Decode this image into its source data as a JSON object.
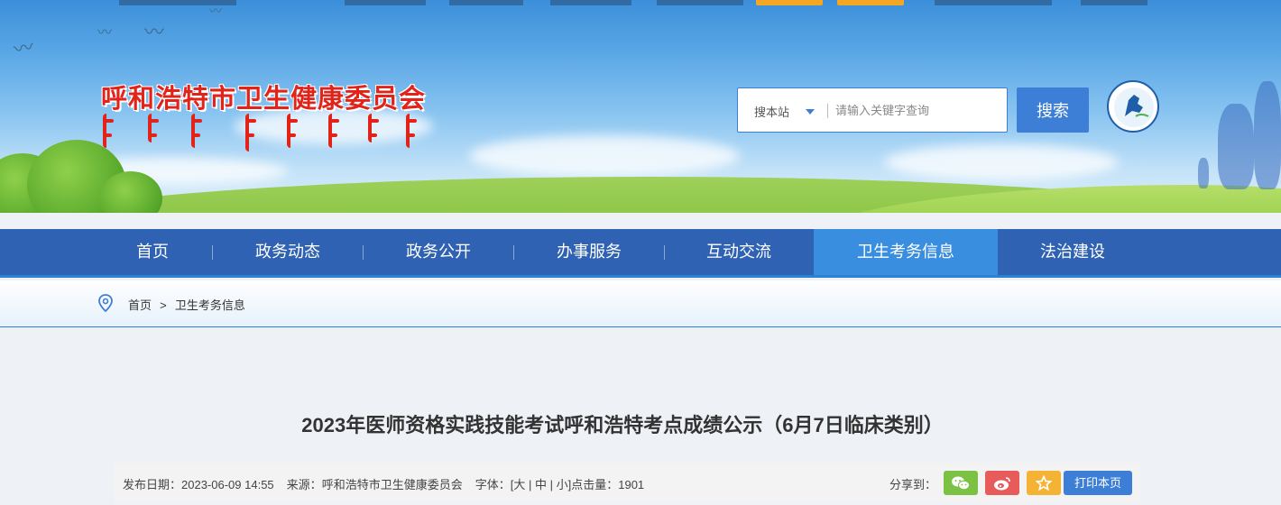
{
  "site": {
    "title": "呼和浩特市卫生健康委员会"
  },
  "search": {
    "scope_label": "搜本站",
    "placeholder": "请输入关键字查询",
    "button_label": "搜索"
  },
  "nav": {
    "items": [
      {
        "label": "首页"
      },
      {
        "label": "政务动态"
      },
      {
        "label": "政务公开"
      },
      {
        "label": "办事服务"
      },
      {
        "label": "互动交流"
      },
      {
        "label": "卫生考务信息",
        "active": true
      },
      {
        "label": "法治建设"
      }
    ]
  },
  "breadcrumb": {
    "home": "首页",
    "separator": ">",
    "current": "卫生考务信息"
  },
  "article": {
    "title": "2023年医师资格实践技能考试呼和浩特考点成绩公示（6月7日临床类别）",
    "date_label": "发布日期：",
    "date": "2023-06-09 14:55",
    "source_label": "来源：",
    "source": "呼和浩特市卫生健康委员会",
    "font_label": "字体：[",
    "font_large": "大",
    "font_medium": "中",
    "font_small": "小",
    "font_close": "]",
    "views_label": "点击量：",
    "views": "1901",
    "share_label": "分享到：",
    "print_label": "打印本页"
  },
  "colors": {
    "nav_bg": "#2f62b3",
    "nav_active": "#3a8ee0",
    "title_red": "#e2231a",
    "wechat": "#7bc144",
    "weibo": "#e85b5b",
    "favorite": "#f5b335",
    "print": "#3d7fd6"
  },
  "icons": {
    "wechat": "wechat-icon",
    "weibo": "weibo-icon",
    "favorite": "star-icon",
    "location": "location-pin-icon"
  }
}
